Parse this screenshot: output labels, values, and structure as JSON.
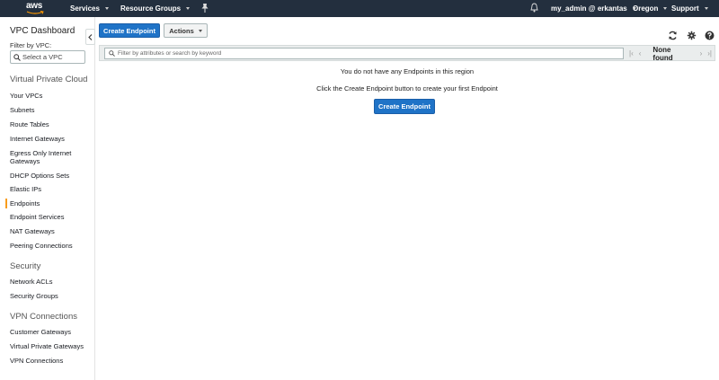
{
  "topnav": {
    "logo": "aws",
    "services": "Services",
    "resource_groups": "Resource Groups",
    "account": "my_admin @ erkantas",
    "region": "Oregon",
    "support": "Support"
  },
  "sidebar": {
    "title": "VPC Dashboard",
    "filter_label": "Filter by VPC:",
    "select_placeholder": "Select a VPC",
    "sections": [
      {
        "title": "Virtual Private Cloud",
        "items": [
          "Your VPCs",
          "Subnets",
          "Route Tables",
          "Internet Gateways",
          "Egress Only Internet Gateways",
          "DHCP Options Sets",
          "Elastic IPs",
          "Endpoints",
          "Endpoint Services",
          "NAT Gateways",
          "Peering Connections"
        ]
      },
      {
        "title": "Security",
        "items": [
          "Network ACLs",
          "Security Groups"
        ]
      },
      {
        "title": "VPN Connections",
        "items": [
          "Customer Gateways",
          "Virtual Private Gateways",
          "VPN Connections"
        ]
      }
    ],
    "active_item": "Endpoints"
  },
  "toolbar": {
    "create_label": "Create Endpoint",
    "actions_label": "Actions"
  },
  "filter": {
    "placeholder": "Filter by attributes or search by keyword",
    "status": "None found"
  },
  "empty": {
    "line1": "You do not have any Endpoints in this region",
    "line2": "Click the Create Endpoint button to create your first Endpoint",
    "button": "Create Endpoint"
  },
  "colors": {
    "nav_bg": "#232f3e",
    "primary": "#1f73c7",
    "active_indicator": "#f89c1c"
  }
}
